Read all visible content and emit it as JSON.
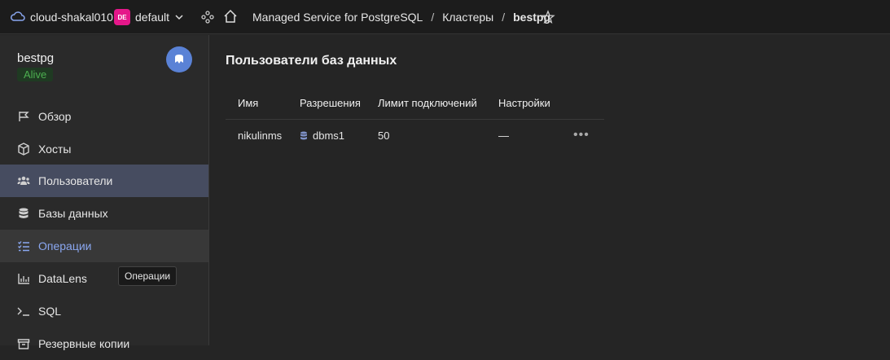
{
  "topbar": {
    "cloud": "cloud-shakal010",
    "folder_badge": "DE",
    "folder": "default",
    "breadcrumbs": [
      "Managed Service for PostgreSQL",
      "Кластеры",
      "bestpg"
    ],
    "separator": "/"
  },
  "sidebar": {
    "cluster_name": "bestpg",
    "status": "Alive",
    "items": [
      {
        "label": "Обзор",
        "icon": "flag-icon"
      },
      {
        "label": "Хосты",
        "icon": "cube-icon"
      },
      {
        "label": "Пользователи",
        "icon": "users-icon",
        "active": true
      },
      {
        "label": "Базы данных",
        "icon": "database-icon"
      },
      {
        "label": "Операции",
        "icon": "checklist-icon",
        "hover": true
      },
      {
        "label": "DataLens",
        "icon": "chart-icon"
      },
      {
        "label": "SQL",
        "icon": "terminal-icon"
      },
      {
        "label": "Резервные копии",
        "icon": "archive-icon"
      }
    ]
  },
  "tooltip": "Операции",
  "main": {
    "title": "Пользователи баз данных",
    "columns": [
      "Имя",
      "Разрешения",
      "Лимит подключений",
      "Настройки"
    ],
    "rows": [
      {
        "name": "nikulinms",
        "permission": "dbms1",
        "limit": "50",
        "settings": "—"
      }
    ]
  },
  "colors": {
    "accent": "#8aa7f0",
    "active_bg": "#464c60",
    "badge": "#e5178a",
    "alive": "#4caf50"
  }
}
